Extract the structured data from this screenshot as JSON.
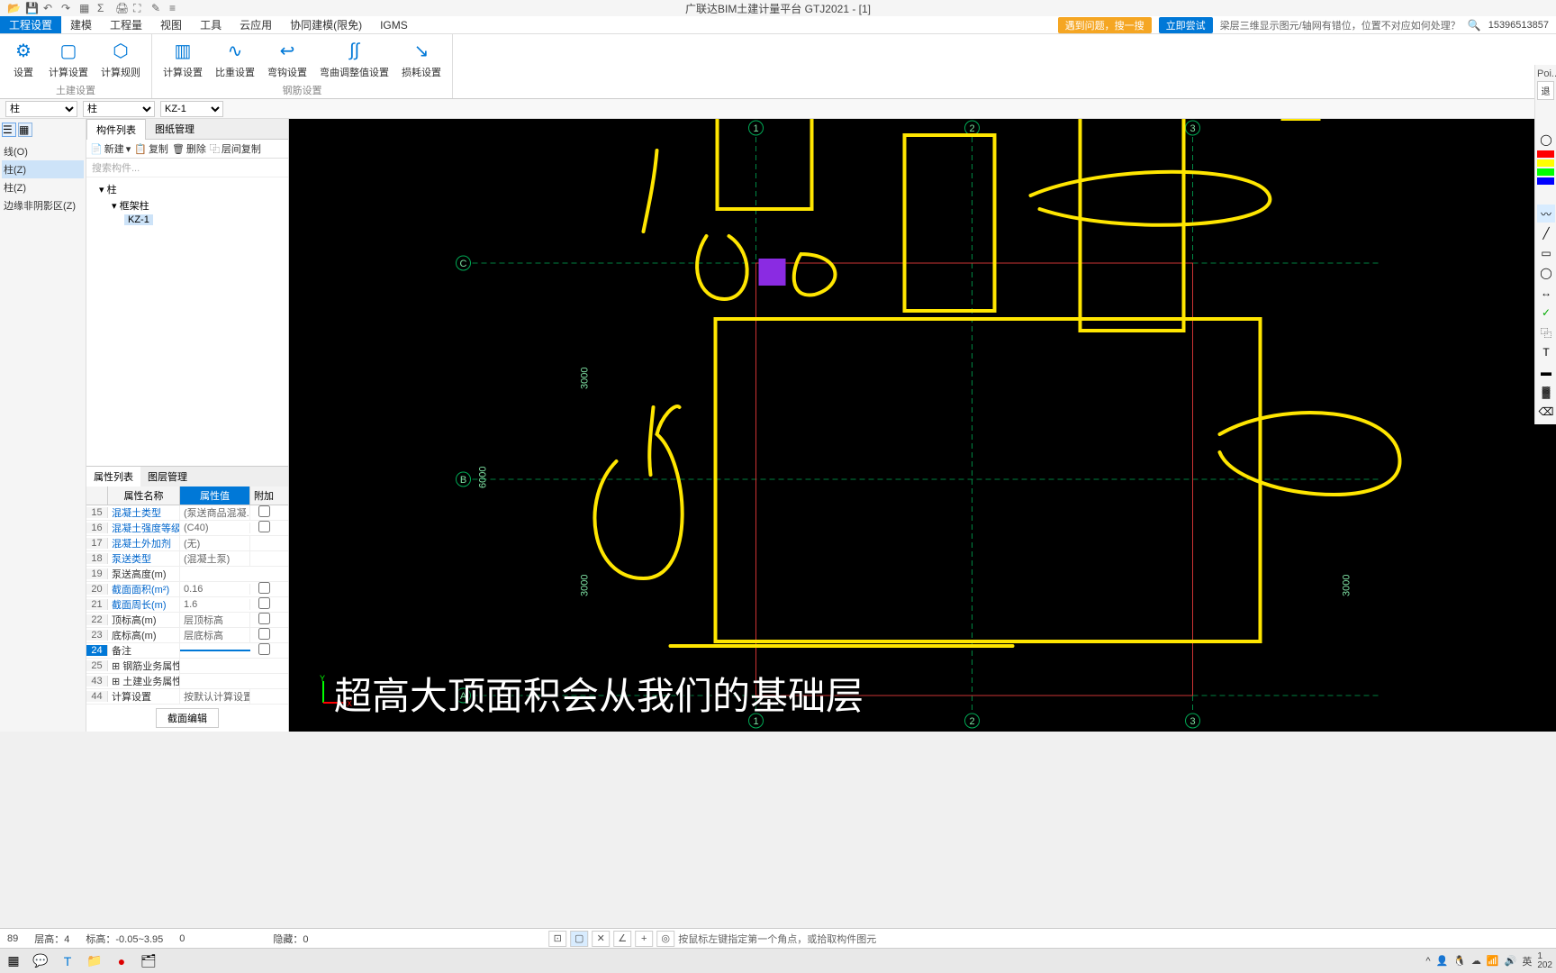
{
  "app_title": "广联达BIM土建计量平台 GTJ2021 - [1]",
  "menu": {
    "items": [
      "工程设置",
      "建模",
      "工程量",
      "视图",
      "工具",
      "云应用",
      "协同建模(限免)",
      "IGMS"
    ],
    "active": 0,
    "search_btn": "遇到问题，搜一搜",
    "try_btn": "立即尝试",
    "tip": "梁层三维显示图元/轴网有错位，位置不对应如何处理？",
    "user": "15396513857"
  },
  "ribbon": {
    "group1": {
      "title": "土建设置",
      "items": [
        {
          "label": "设置",
          "icon": "⚙"
        },
        {
          "label": "计算设置",
          "icon": "🖩"
        },
        {
          "label": "计算规则",
          "icon": "⬡"
        }
      ]
    },
    "group2": {
      "title": "钢筋设置",
      "items": [
        {
          "label": "计算设置",
          "icon": "✎"
        },
        {
          "label": "比重设置",
          "icon": "∿"
        },
        {
          "label": "弯钩设置",
          "icon": "↩"
        },
        {
          "label": "弯曲调整值设置",
          "icon": "∫"
        },
        {
          "label": "损耗设置",
          "icon": "↘"
        }
      ]
    }
  },
  "selectors": {
    "type1": "柱",
    "type2": "柱",
    "instance": "KZ-1"
  },
  "left_tree": {
    "items": [
      "线(O)",
      "柱(Z)",
      "柱(Z)",
      "边缘非阴影区(Z)"
    ],
    "sel_index": 1
  },
  "mid": {
    "tabs": [
      "构件列表",
      "图纸管理"
    ],
    "toolbar": {
      "new": "新建",
      "copy": "复制",
      "delete": "删除",
      "layer_copy": "层间复制"
    },
    "search_ph": "搜索构件...",
    "tree": {
      "root": "柱",
      "child": "框架柱",
      "item": "KZ-1"
    }
  },
  "props": {
    "tabs": [
      "属性列表",
      "图层管理"
    ],
    "headers": {
      "name": "属性名称",
      "value": "属性值",
      "extra": "附加"
    },
    "rows": [
      {
        "n": "15",
        "name": "混凝土类型",
        "value": "(泵送商品混凝...",
        "link": true,
        "chk": true
      },
      {
        "n": "16",
        "name": "混凝土强度等级",
        "value": "(C40)",
        "link": true,
        "chk": true
      },
      {
        "n": "17",
        "name": "混凝土外加剂",
        "value": "(无)",
        "link": true,
        "chk": false
      },
      {
        "n": "18",
        "name": "泵送类型",
        "value": "(混凝土泵)",
        "link": true,
        "chk": false
      },
      {
        "n": "19",
        "name": "泵送高度(m)",
        "value": "",
        "link": false,
        "chk": false
      },
      {
        "n": "20",
        "name": "截面面积(m²)",
        "value": "0.16",
        "link": true,
        "chk": true
      },
      {
        "n": "21",
        "name": "截面周长(m)",
        "value": "1.6",
        "link": true,
        "chk": true
      },
      {
        "n": "22",
        "name": "顶标高(m)",
        "value": "层顶标高",
        "link": false,
        "chk": true
      },
      {
        "n": "23",
        "name": "底标高(m)",
        "value": "层底标高",
        "link": false,
        "chk": true
      },
      {
        "n": "24",
        "name": "备注",
        "value": "",
        "link": false,
        "chk": true,
        "selected": true
      },
      {
        "n": "25",
        "name": "⊞ 钢筋业务属性",
        "value": "",
        "link": false,
        "chk": false
      },
      {
        "n": "43",
        "name": "⊞ 土建业务属性",
        "value": "",
        "link": false,
        "chk": false
      },
      {
        "n": "44",
        "name": "  计算设置",
        "value": "按默认计算设置",
        "link": false,
        "chk": false
      }
    ],
    "section_btn": "截面编辑"
  },
  "canvas": {
    "grid_labels": {
      "cols": [
        "1",
        "2",
        "3"
      ],
      "rows": [
        "A",
        "B",
        "C"
      ]
    },
    "dims": {
      "v1": "3000",
      "v2": "6000",
      "v3": "3000",
      "h1": "3000"
    }
  },
  "subtitle": "超高大顶面积会从我们的基础层",
  "status": {
    "left_num": "89",
    "layer_label": "层高：",
    "layer_val": "4",
    "elev_label": "标高：",
    "elev_val": "-0.05~3.95",
    "zero": "0",
    "hide_label": "隐藏：",
    "hide_val": "0",
    "hint": "按鼠标左键指定第一个角点，或拾取构件图元"
  },
  "right_label_poi": "Poi...",
  "right_label_esc": "退"
}
